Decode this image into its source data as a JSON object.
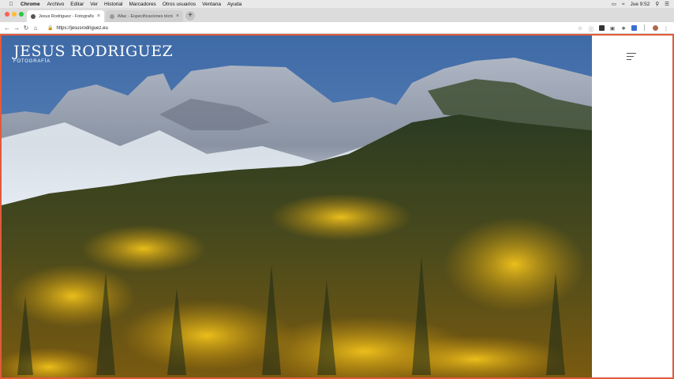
{
  "menubar": {
    "app_name": "Chrome",
    "items": [
      "Archivo",
      "Editar",
      "Ver",
      "Historial",
      "Marcadores",
      "Otros usuarios",
      "Ventana",
      "Ayuda"
    ],
    "clock": "Jue 9:52"
  },
  "tabs": [
    {
      "label": "Jesus Rodriguez - Fotografía de",
      "active": true
    },
    {
      "label": "iMac - Especificaciones técnica",
      "active": false
    }
  ],
  "toolbar": {
    "url": "https://jesusrodriguez.eu"
  },
  "site": {
    "title": "JESUS RODRIGUEZ",
    "subtitle": "FOTOGRAFÍA"
  },
  "colors": {
    "accent_border": "#e25a3c",
    "close": "#ff5f57",
    "minimize": "#febc2e",
    "zoom": "#28c840"
  },
  "icons": {
    "menu": "hamburger-menu-icon"
  }
}
